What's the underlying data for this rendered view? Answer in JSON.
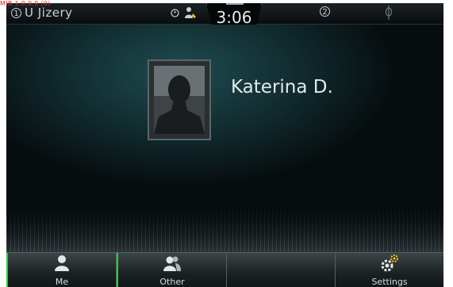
{
  "status_bar": {
    "location_badge": "1",
    "location": "U Jizery",
    "clock": "3:06",
    "notification_count": "2",
    "version_text": "MIB 1.0.0.9 (0)"
  },
  "contact": {
    "name": "Katerina D."
  },
  "bottom_bar": {
    "buttons": [
      {
        "label": "Me",
        "icon": "person-icon",
        "active": true
      },
      {
        "label": "Other",
        "icon": "people-icon",
        "active": false
      },
      {
        "label": "",
        "icon": "",
        "active": false
      },
      {
        "label": "Settings",
        "icon": "gear-icon",
        "active": false
      }
    ]
  },
  "colors": {
    "accent": "#39c64a",
    "gear_accent": "#f5c518",
    "version_text": "#dd2222"
  }
}
